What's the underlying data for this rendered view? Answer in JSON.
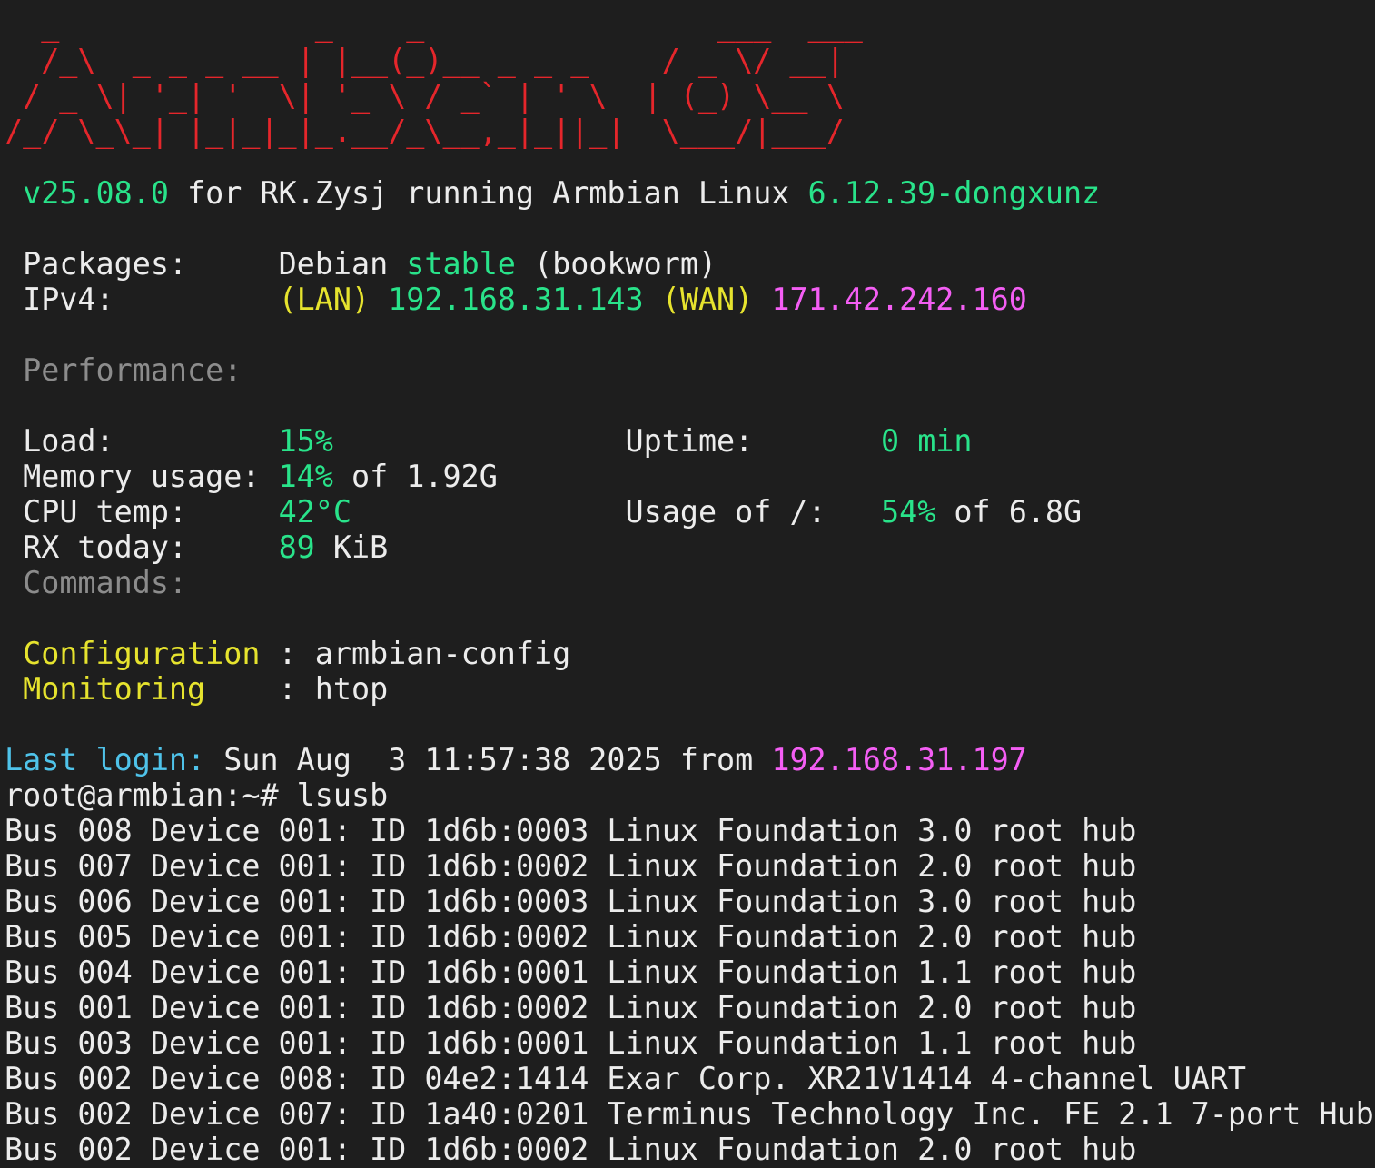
{
  "banner": [
    "  _              _    _                ___  ___ ",
    "  /_\\  _ _ _ __ | |__(_)__ _ _ _    / _ \\/ __|",
    " / _ \\| '_| '  \\| '_ \\ / _` | ' \\  | (_) \\__ \\",
    "/_/ \\_\\_| |_|_|_|_.__/_\\__,_|_||_|  \\___/|___/"
  ],
  "header": {
    "version": "v25.08.0",
    "for_text": " for RK.Zysj running Armbian Linux ",
    "kernel": "6.12.39-dongxunz"
  },
  "info": {
    "packages_label": "Packages:     ",
    "packages_dist": "Debian ",
    "packages_branch": "stable",
    "packages_codename": " (bookworm)",
    "ipv4_label": "IPv4:         ",
    "lan_tag": "(LAN) ",
    "lan_ip": "192.168.31.143",
    "wan_tag": " (WAN) ",
    "wan_ip": "171.42.242.160"
  },
  "performance": {
    "heading": "Performance:",
    "load_label": "Load:         ",
    "load_value": "15%",
    "load_pad": "                ",
    "uptime_label": "Uptime:       ",
    "uptime_value": "0 min",
    "memory_label": "Memory usage: ",
    "memory_value": "14%",
    "memory_total": " of 1.92G",
    "cpu_label": "CPU temp:     ",
    "cpu_value": "42°C",
    "cpu_pad": "               ",
    "disk_label": "Usage of /:   ",
    "disk_value": "54%",
    "disk_total": " of 6.8G",
    "rx_label": "RX today:     ",
    "rx_value": "89",
    "rx_unit": " KiB"
  },
  "commands": {
    "heading": "Commands:",
    "config_label": "Configuration",
    "config_sep": " : ",
    "config_cmd": "armbian-config",
    "monitor_label": "Monitoring   ",
    "monitor_sep": " : ",
    "monitor_cmd": "htop"
  },
  "login": {
    "label": "Last login:",
    "when": " Sun Aug  3 11:57:38 2025 from ",
    "ip": "192.168.31.197"
  },
  "prompt": {
    "text": "root@armbian:~# ",
    "command": "lsusb"
  },
  "lsusb_output": [
    "Bus 008 Device 001: ID 1d6b:0003 Linux Foundation 3.0 root hub",
    "Bus 007 Device 001: ID 1d6b:0002 Linux Foundation 2.0 root hub",
    "Bus 006 Device 001: ID 1d6b:0003 Linux Foundation 3.0 root hub",
    "Bus 005 Device 001: ID 1d6b:0002 Linux Foundation 2.0 root hub",
    "Bus 004 Device 001: ID 1d6b:0001 Linux Foundation 1.1 root hub",
    "Bus 001 Device 001: ID 1d6b:0002 Linux Foundation 2.0 root hub",
    "Bus 003 Device 001: ID 1d6b:0001 Linux Foundation 1.1 root hub",
    "Bus 002 Device 008: ID 04e2:1414 Exar Corp. XR21V1414 4-channel UART",
    "Bus 002 Device 007: ID 1a40:0201 Terminus Technology Inc. FE 2.1 7-port Hub",
    "Bus 002 Device 001: ID 1d6b:0002 Linux Foundation 2.0 root hub"
  ],
  "colors": {
    "background": "#1e1e1e",
    "banner": "#e5262b",
    "green": "#29e38a",
    "yellow": "#e6e32e",
    "magenta": "#f45ef4",
    "cyan": "#4fc3ea",
    "gray": "#8c8c8c"
  }
}
